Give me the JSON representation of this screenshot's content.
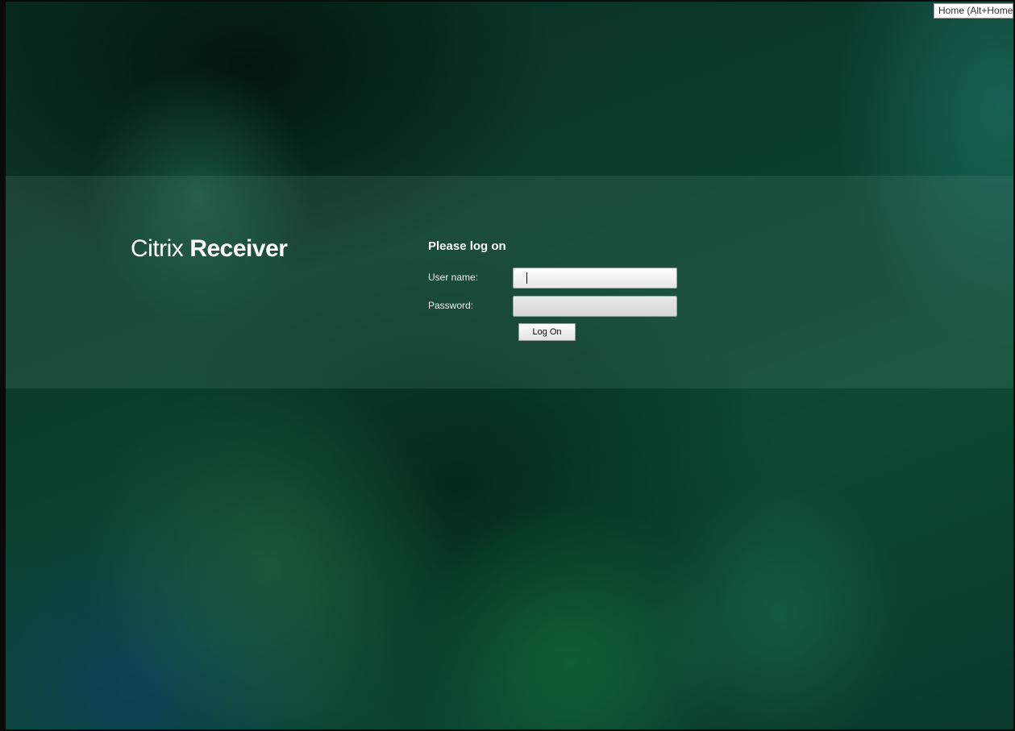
{
  "app": {
    "logo_light": "Citrix",
    "logo_bold": "Receiver"
  },
  "login": {
    "title": "Please log on",
    "username_label": "User name:",
    "username_value": "",
    "password_label": "Password:",
    "password_value": "",
    "submit_label": "Log On"
  },
  "tooltip": {
    "text": "Home (Alt+Home)"
  },
  "colors": {
    "background": "#0b3d2c",
    "band": "#4e7f70",
    "text": "#ffffff"
  }
}
